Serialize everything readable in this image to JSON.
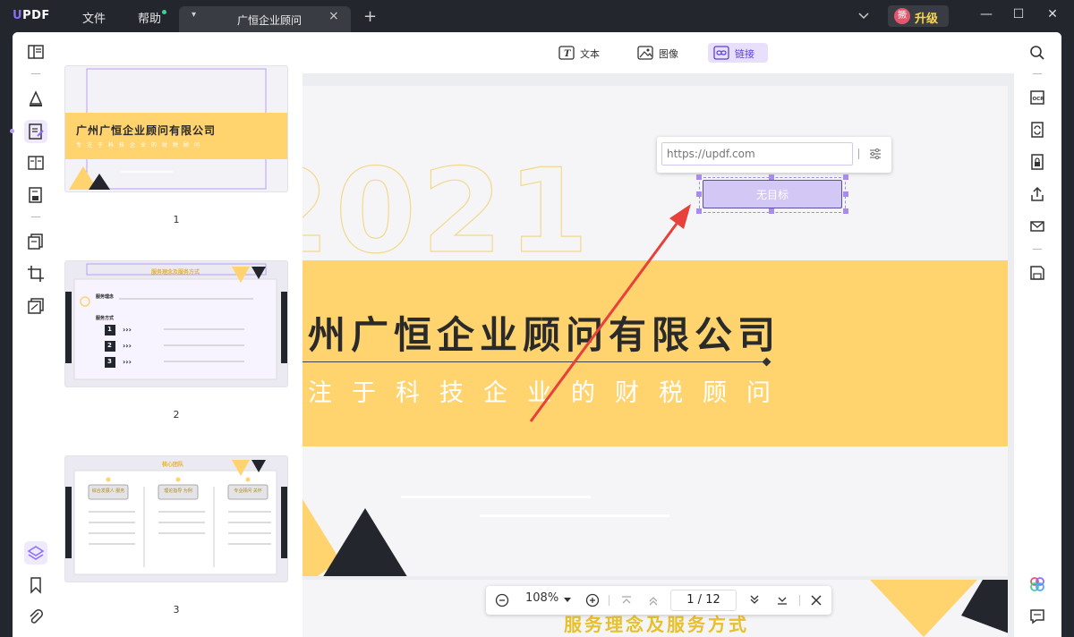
{
  "app": {
    "logo": "UPDF"
  },
  "menus": {
    "file": "文件",
    "help": "帮助"
  },
  "tab": {
    "title": "广恒企业顾问",
    "close": "×",
    "new": "+"
  },
  "account": {
    "avatar_text": "撅",
    "upgrade_label": "升级"
  },
  "window_controls": {
    "minimize": "—",
    "maximize": "☐",
    "close": "✕"
  },
  "edit_toolbar": {
    "text_label": "文本",
    "image_label": "图像",
    "link_label": "链接"
  },
  "thumbnails": [
    {
      "page": "1",
      "title": "广州广恒企业顾问有限公司",
      "subtitle": "专注于科技企业的财税顾问"
    },
    {
      "page": "2",
      "title": "服务理念及服务方式",
      "section1": "服务理念",
      "section2": "服务方式",
      "steps": [
        "1",
        "2",
        "3"
      ]
    },
    {
      "page": "3",
      "title": "核心团队",
      "cards": [
        "综合发展人 服务",
        "理论指导 为例",
        "专业顾问 关怀"
      ]
    }
  ],
  "page1": {
    "year": "2021",
    "company": "州广恒企业顾问有限公司",
    "slogan": "注于科技企业的财税顾问"
  },
  "page2_peek": {
    "title": "服务理念及服务方式"
  },
  "link_popup": {
    "url_placeholder": "https://updf.com",
    "target_label": "无目标"
  },
  "zoom_bar": {
    "zoom": "108%",
    "current_page": "1",
    "separator": "/",
    "total_pages": "12"
  },
  "colors": {
    "accent": "#8b6cff",
    "band": "#ffd36e",
    "dark": "#24262d",
    "arrow": "#e8403a"
  }
}
